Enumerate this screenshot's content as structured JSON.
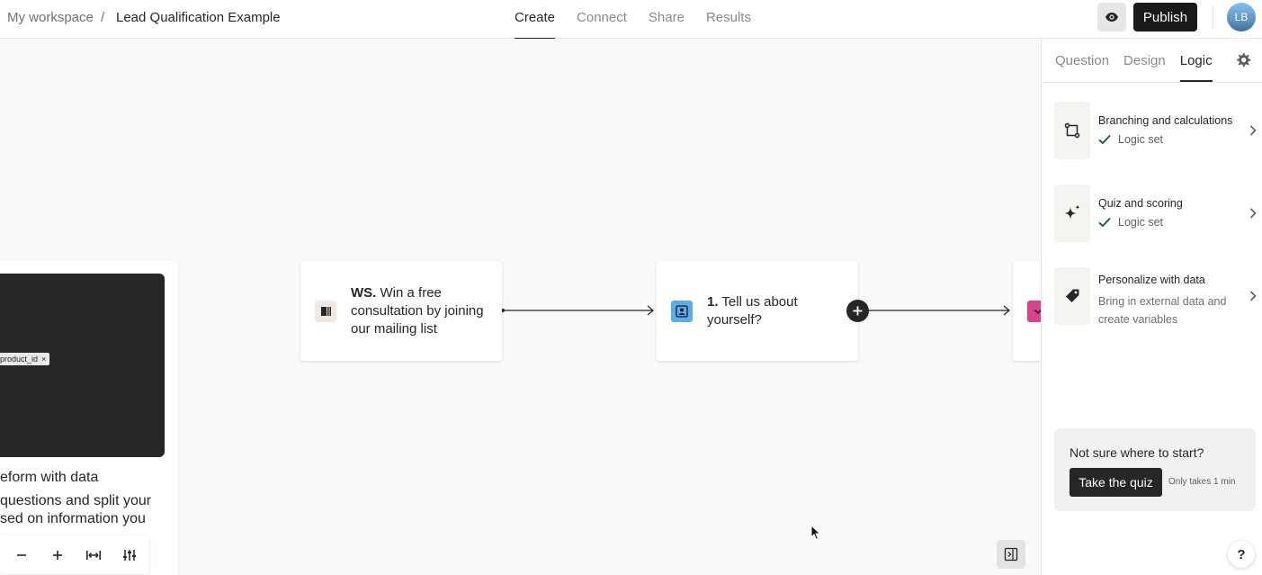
{
  "breadcrumb": {
    "workspace": "My workspace",
    "separator": "/",
    "form_name": "Lead Qualification Example"
  },
  "nav_tabs": [
    {
      "label": "Create",
      "active": true
    },
    {
      "label": "Connect",
      "active": false
    },
    {
      "label": "Share",
      "active": false
    },
    {
      "label": "Results",
      "active": false
    }
  ],
  "header": {
    "publish_label": "Publish",
    "avatar_initials": "LB"
  },
  "canvas": {
    "left_card": {
      "tag": "product_id",
      "tag_close": "×",
      "title": "eform with data",
      "desc_line1": "questions and split your",
      "desc_line2": "sed on information you"
    },
    "nodes": [
      {
        "ref": "WS.",
        "text": "Win a free consultation by joining our mailing list",
        "icon": "welcome-screen-icon"
      },
      {
        "ref": "1.",
        "text": "Tell us about yourself?",
        "icon": "contact-card-icon"
      },
      {
        "ref": "",
        "text": "",
        "icon": "dropdown-icon"
      }
    ],
    "zoom_controls": [
      "zoom-out",
      "zoom-in",
      "fit-width",
      "adjust"
    ]
  },
  "right_panel": {
    "tabs": [
      {
        "label": "Question",
        "active": false
      },
      {
        "label": "Design",
        "active": false
      },
      {
        "label": "Logic",
        "active": true
      }
    ],
    "options": [
      {
        "title": "Branching and calculations",
        "status": "Logic set",
        "icon": "branching-icon"
      },
      {
        "title": "Quiz and scoring",
        "status": "Logic set",
        "icon": "sparkle-icon"
      },
      {
        "title": "Personalize with data",
        "desc": "Bring in external data and create variables",
        "icon": "tag-icon"
      }
    ],
    "quiz_prompt": {
      "question": "Not sure where to start?",
      "button": "Take the quiz",
      "note": "Only takes 1 min"
    },
    "help_label": "?"
  },
  "colors": {
    "accent_dark": "#262627",
    "contact_icon_bg": "#5cabea",
    "dropdown_icon_bg": "#d9438c",
    "welcome_icon_bg": "#efeae1"
  }
}
